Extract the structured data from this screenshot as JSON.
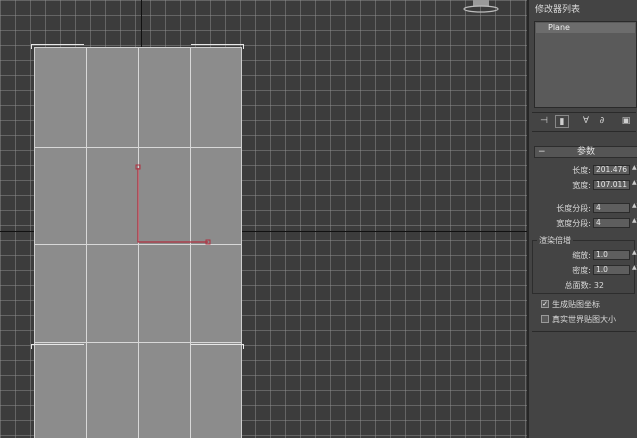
{
  "panel": {
    "title": "修改器列表",
    "modifier_stack": [
      "Plane"
    ],
    "toolbar_icons": [
      "pin-stack-icon",
      "show-end-result-icon",
      "make-unique-icon",
      "remove-modifier-icon",
      "configure-sets-icon"
    ],
    "rollout": {
      "title": "参数",
      "length_label": "长度:",
      "length_value": "201.476",
      "width_label": "宽度:",
      "width_value": "107.011",
      "length_segs_label": "长度分段:",
      "length_segs_value": "4",
      "width_segs_label": "宽度分段:",
      "width_segs_value": "4",
      "render_group_title": "渲染倍增",
      "scale_label": "缩放:",
      "scale_value": "1.0",
      "density_label": "密度:",
      "density_value": "1.0",
      "total_faces_label": "总面数: 32",
      "gen_map_coords_label": "生成贴图坐标",
      "gen_map_coords_checked": true,
      "real_world_map_label": "真实世界贴图大小",
      "real_world_map_checked": false
    }
  },
  "colors": {
    "viewport_bg": "#3c3c3c",
    "plane_fill": "#8c8c8c",
    "gizmo": "#b03040",
    "panel_bg": "#444444"
  }
}
